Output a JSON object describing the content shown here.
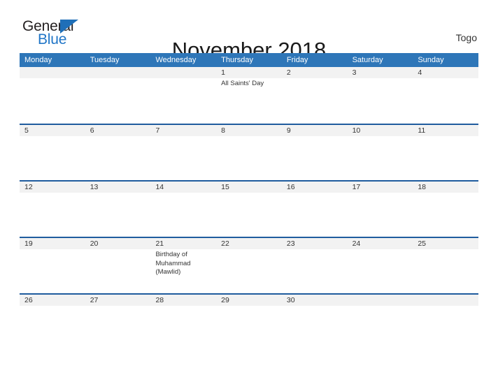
{
  "brand": {
    "name_part1": "General",
    "name_part2": "Blue",
    "flag_icon": "blue-triangle-flag"
  },
  "header": {
    "title": "November 2018",
    "country": "Togo"
  },
  "colors": {
    "header_blue": "#2e76b8",
    "row_rule_blue": "#1f5c9e",
    "date_band_gray": "#f2f2f2",
    "logo_blue": "#2176c7",
    "text": "#333333"
  },
  "calendar": {
    "month": "November",
    "year": "2018",
    "weekday_headers": [
      "Monday",
      "Tuesday",
      "Wednesday",
      "Thursday",
      "Friday",
      "Saturday",
      "Sunday"
    ],
    "weeks": [
      [
        {
          "date": "",
          "events": []
        },
        {
          "date": "",
          "events": []
        },
        {
          "date": "",
          "events": []
        },
        {
          "date": "1",
          "events": [
            "All Saints' Day"
          ]
        },
        {
          "date": "2",
          "events": []
        },
        {
          "date": "3",
          "events": []
        },
        {
          "date": "4",
          "events": []
        }
      ],
      [
        {
          "date": "5",
          "events": []
        },
        {
          "date": "6",
          "events": []
        },
        {
          "date": "7",
          "events": []
        },
        {
          "date": "8",
          "events": []
        },
        {
          "date": "9",
          "events": []
        },
        {
          "date": "10",
          "events": []
        },
        {
          "date": "11",
          "events": []
        }
      ],
      [
        {
          "date": "12",
          "events": []
        },
        {
          "date": "13",
          "events": []
        },
        {
          "date": "14",
          "events": []
        },
        {
          "date": "15",
          "events": []
        },
        {
          "date": "16",
          "events": []
        },
        {
          "date": "17",
          "events": []
        },
        {
          "date": "18",
          "events": []
        }
      ],
      [
        {
          "date": "19",
          "events": []
        },
        {
          "date": "20",
          "events": []
        },
        {
          "date": "21",
          "events": [
            "Birthday of Muhammad (Mawlid)"
          ]
        },
        {
          "date": "22",
          "events": []
        },
        {
          "date": "23",
          "events": []
        },
        {
          "date": "24",
          "events": []
        },
        {
          "date": "25",
          "events": []
        }
      ],
      [
        {
          "date": "26",
          "events": []
        },
        {
          "date": "27",
          "events": []
        },
        {
          "date": "28",
          "events": []
        },
        {
          "date": "29",
          "events": []
        },
        {
          "date": "30",
          "events": []
        },
        {
          "date": "",
          "events": []
        },
        {
          "date": "",
          "events": []
        }
      ]
    ]
  }
}
